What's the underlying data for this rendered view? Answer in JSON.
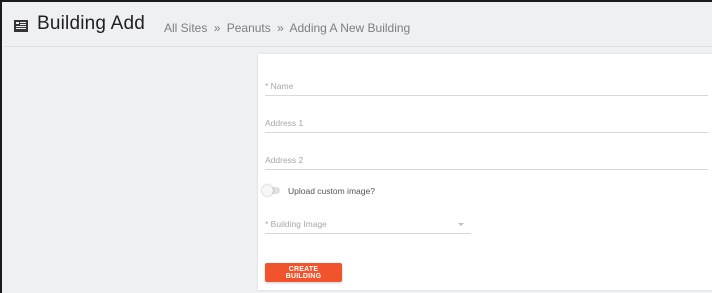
{
  "header": {
    "title": "Building Add",
    "icon": "building-icon",
    "breadcrumb": [
      {
        "label": "All Sites"
      },
      {
        "label": "Peanuts"
      },
      {
        "label": "Adding A New Building"
      }
    ],
    "separator": "»"
  },
  "form": {
    "fields": [
      {
        "label": "* Name",
        "value": ""
      },
      {
        "label": "Address 1",
        "value": ""
      },
      {
        "label": "Address 2",
        "value": ""
      }
    ],
    "upload_toggle": {
      "label": "Upload custom image?",
      "checked": false
    },
    "building_image": {
      "label": "* Building Image",
      "value": ""
    },
    "submit_label": "CREATE BUILDING"
  },
  "colors": {
    "accent": "#f1542c",
    "background": "#eef0f2",
    "card": "#ffffff"
  }
}
